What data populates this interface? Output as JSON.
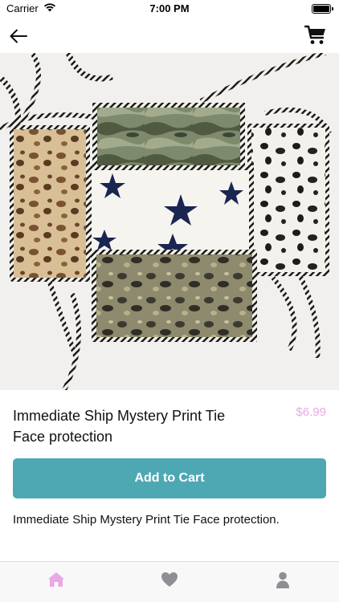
{
  "status_bar": {
    "carrier": "Carrier",
    "time": "7:00 PM"
  },
  "nav": {
    "back_icon": "arrow-left-icon",
    "cart_icon": "shopping-cart-icon"
  },
  "product": {
    "image_description": "patterned-face-masks-photo",
    "title": "Immediate Ship Mystery Print Tie Face protection",
    "price": "$6.99",
    "add_to_cart_label": "Add to Cart",
    "description": "Immediate Ship Mystery Print Tie Face protection."
  },
  "tab_bar": {
    "tabs": [
      {
        "icon": "home-icon",
        "active": true
      },
      {
        "icon": "heart-icon",
        "active": false
      },
      {
        "icon": "person-icon",
        "active": false
      }
    ]
  },
  "colors": {
    "accent": "#4ea8b3",
    "price": "#e9a8e6",
    "active_tab": "#e9a8e6",
    "inactive_tab": "#8e8e93"
  }
}
